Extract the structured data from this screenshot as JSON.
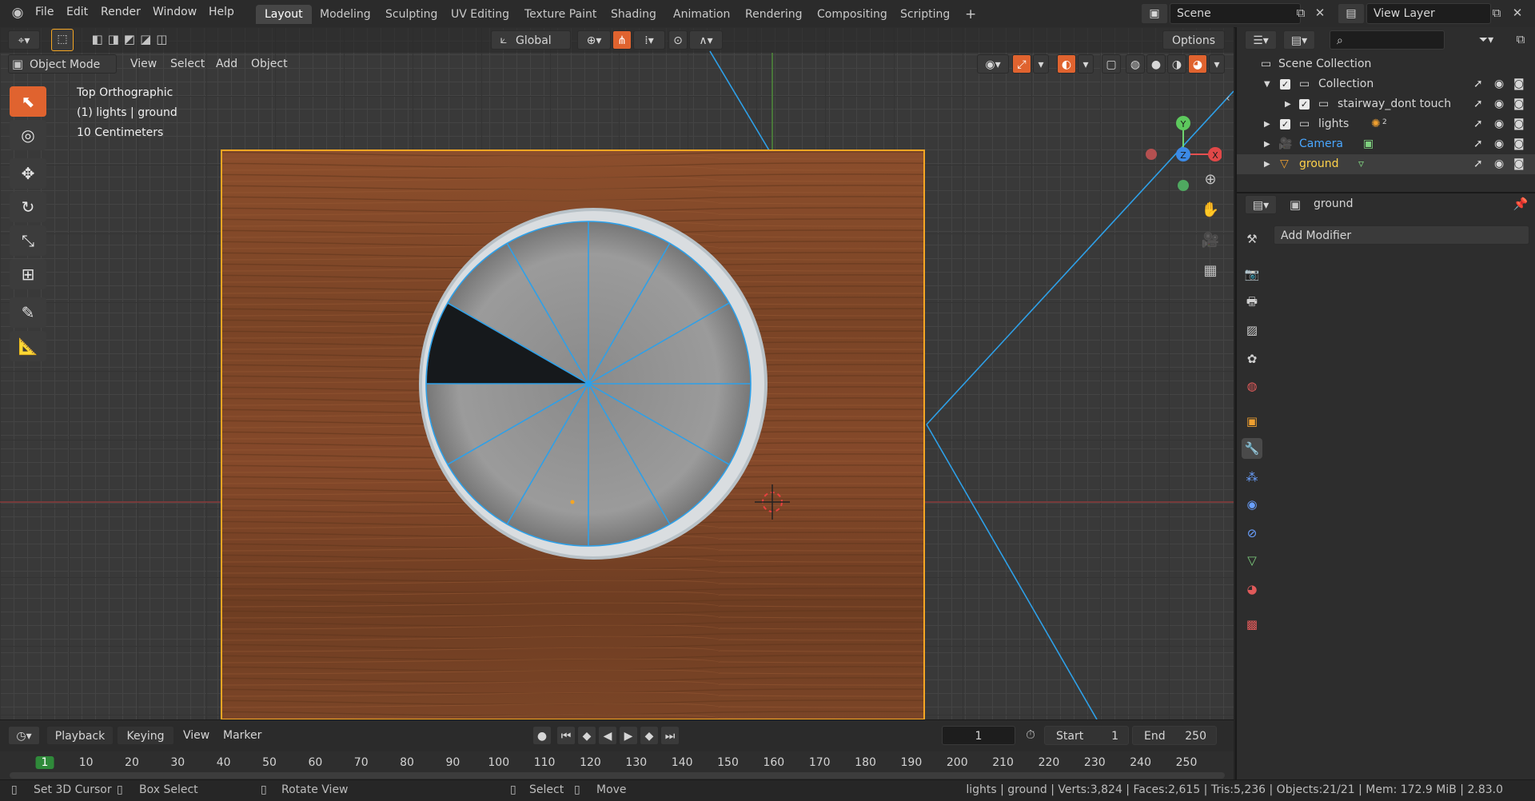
{
  "topbar": {
    "menus": [
      "File",
      "Edit",
      "Render",
      "Window",
      "Help"
    ],
    "workspaces": [
      "Layout",
      "Modeling",
      "Sculpting",
      "UV Editing",
      "Texture Paint",
      "Shading",
      "Animation",
      "Rendering",
      "Compositing",
      "Scripting"
    ],
    "active_workspace": "Layout",
    "add_tab": "+",
    "scene_label": "Scene",
    "view_layer_label": "View Layer"
  },
  "tool_header": {
    "transform_orientation": "Global",
    "options_label": "Options"
  },
  "viewport_header": {
    "mode": "Object Mode",
    "menus": [
      "View",
      "Select",
      "Add",
      "Object"
    ]
  },
  "viewport": {
    "view_name": "Top Orthographic",
    "collection_object": "(1) lights | ground",
    "scale": "10 Centimeters",
    "gizmo": {
      "x": "X",
      "y": "Y",
      "z": "Z"
    }
  },
  "outliner": {
    "root": "Scene Collection",
    "rows": [
      {
        "label": "Collection"
      },
      {
        "label": "stairway_dont touch"
      },
      {
        "label": "lights",
        "badge": "2"
      },
      {
        "label": "Camera"
      },
      {
        "label": "ground"
      }
    ],
    "colors": {
      "camera": "#4aa7ff",
      "ground": "#ffd24a",
      "selection": "#3e3e3e"
    }
  },
  "properties": {
    "object_name": "ground",
    "add_modifier": "Add Modifier",
    "tab_icons": [
      "tool-icon",
      "render-icon",
      "output-icon",
      "view-layer-icon",
      "scene-icon",
      "world-icon",
      "object-icon",
      "modifier-icon",
      "particles-icon",
      "physics-icon",
      "constraints-icon",
      "data-icon",
      "material-icon",
      "texture-icon"
    ]
  },
  "timeline": {
    "menus": [
      "Playback",
      "Keying",
      "View",
      "Marker"
    ],
    "current_frame": "1",
    "start_label": "Start",
    "start": "1",
    "end_label": "End",
    "end": "250",
    "ruler": [
      "1",
      "10",
      "20",
      "30",
      "40",
      "50",
      "60",
      "70",
      "80",
      "90",
      "100",
      "110",
      "120",
      "130",
      "140",
      "150",
      "160",
      "170",
      "180",
      "190",
      "200",
      "210",
      "220",
      "230",
      "240",
      "250"
    ]
  },
  "statusbar": {
    "set_cursor": "Set 3D Cursor",
    "box_select": "Box Select",
    "rotate_view": "Rotate View",
    "select": "Select",
    "move": "Move",
    "stats": "lights | ground | Verts:3,824 | Faces:2,615 | Tris:5,236 | Objects:21/21 | Mem: 172.9 MiB | 2.83.0"
  },
  "colors": {
    "accent": "#e0632f",
    "wireframe": "#2ea0e8",
    "selection_outline": "#f5a623"
  }
}
